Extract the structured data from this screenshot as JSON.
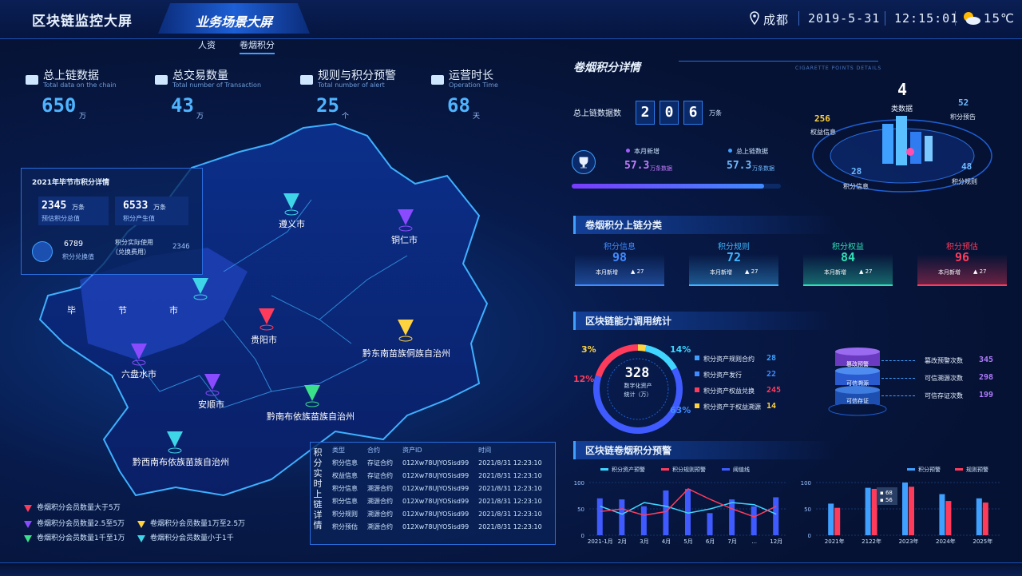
{
  "header": {
    "title": "区块链监控大屏",
    "active_tab": "业务场景大屏",
    "subtabs": [
      "人资",
      "卷烟积分"
    ],
    "city": "成都",
    "date": "2019-5-31",
    "time": "12:15:01",
    "temperature": "15℃",
    "icons": {
      "location": "location-pin-icon",
      "weather": "partly-cloudy-icon"
    }
  },
  "stats": [
    {
      "title": "总上链数据",
      "sub": "Total data on the chain",
      "value": "650",
      "unit": "万",
      "icon": "bank-icon"
    },
    {
      "title": "总交易数量",
      "sub": "Total number of Transaction",
      "value": "43",
      "unit": "万",
      "icon": "cash-register-icon"
    },
    {
      "title": "规则与积分预警",
      "sub": "Total number of alert",
      "value": "25",
      "unit": "个",
      "icon": "star-icon"
    },
    {
      "title": "运营时长",
      "sub": "Operation Time",
      "value": "68",
      "unit": "天",
      "icon": "clock-icon"
    }
  ],
  "popup": {
    "title": "2021年毕节市积分详情",
    "box1_value": "2345",
    "box1_unit": "万条",
    "box1_label": "预估积分总值",
    "box2_value": "6533",
    "box2_unit": "万条",
    "box2_label": "积分产生值",
    "exchange_value": "6789",
    "exchange_label": "积分兑换值",
    "usage_label1": "积分实际使用",
    "usage_label2": "（兑换费用）",
    "usage_value": "2346"
  },
  "map": {
    "regions": [
      "遵义市",
      "铜仁市",
      "毕",
      "节",
      "市",
      "贵阳市",
      "黔东南苗族侗族自治州",
      "六盘水市",
      "安顺市",
      "黔南布依族苗族自治州",
      "黔西南布依族苗族自治州"
    ],
    "legend": [
      {
        "label": "卷烟积分会员数量大于5万",
        "color": "#ff3b5c"
      },
      {
        "label": "卷烟积分会员数量2.5至5万",
        "color": "#8a4bff"
      },
      {
        "label": "卷烟积分会员数量1万至2.5万",
        "color": "#ffd23f"
      },
      {
        "label": "卷烟积分会员数量1千至1万",
        "color": "#3be08a"
      },
      {
        "label": "卷烟积分会员数量小于1千",
        "color": "#3fd5e8"
      }
    ]
  },
  "realtime": {
    "side_title": "积分实时上链详情",
    "headers": [
      "类型",
      "合约",
      "资产ID",
      "时间"
    ],
    "rows": [
      [
        "积分信息",
        "存证合约",
        "012Xw78UJYOSisd99",
        "2021/8/31 12:23:10"
      ],
      [
        "权益信息",
        "存证合约",
        "012Xw78UJYOSisd99",
        "2021/8/31 12:23:10"
      ],
      [
        "积分信息",
        "溯源合约",
        "012Xw78UJYOSisd99",
        "2021/8/31 12:23:10"
      ],
      [
        "积分信息",
        "溯源合约",
        "012Xw78UJYOSisd99",
        "2021/8/31 12:23:10"
      ],
      [
        "积分规则",
        "溯源合约",
        "012Xw78UJYOSisd99",
        "2021/8/31 12:23:10"
      ],
      [
        "积分预估",
        "溯源合约",
        "012Xw78UJYOSisd99",
        "2021/8/31 12:23:10"
      ]
    ]
  },
  "details": {
    "title": "卷烟积分详情",
    "subtitle": "CIGARETTE POINTS DETAILS",
    "total_label": "总上链数据数",
    "total_digits": [
      "2",
      "0",
      "6"
    ],
    "total_unit": "万条",
    "month_new_label": "本月新增",
    "month_new_value": "57.3",
    "month_new_unit": "万条数据",
    "total_chain_label": "总上链数据",
    "total_chain_value": "57.3",
    "total_chain_unit": "万条数据",
    "progress": 0.92,
    "ring": {
      "center_value": "4",
      "center_label": "类数据",
      "items": [
        {
          "value": "256",
          "label": "权益信息"
        },
        {
          "value": "52",
          "label": "积分预告"
        },
        {
          "value": "28",
          "label": "积分信息"
        },
        {
          "value": "48",
          "label": "积分规则"
        }
      ]
    }
  },
  "classify": {
    "title": "卷烟积分上链分类",
    "cards": [
      {
        "name": "积分信息",
        "value": "98",
        "new_label": "本月新增",
        "new_value": "▲ 27",
        "color": "#3f8bff"
      },
      {
        "name": "积分规则",
        "value": "72",
        "new_label": "本月新增",
        "new_value": "▲ 27",
        "color": "#3fb5ff"
      },
      {
        "name": "积分权益",
        "value": "84",
        "new_label": "本月新增",
        "new_value": "▲ 27",
        "color": "#2fe0b5"
      },
      {
        "name": "积分预估",
        "value": "96",
        "new_label": "本月新增",
        "new_value": "▲ 27",
        "color": "#ff3b5c"
      }
    ]
  },
  "ability": {
    "title": "区块链能力调用统计",
    "center_value": "328",
    "center_label1": "数字化资产",
    "center_label2": "统计（万）",
    "pct_labels": [
      "3%",
      "14%",
      "12%",
      "63%"
    ],
    "items": [
      {
        "label": "积分资产规则合约",
        "value": "28",
        "color": "#3fa0ff"
      },
      {
        "label": "积分资产发行",
        "value": "22",
        "color": "#3f8bff"
      },
      {
        "label": "积分资产权益兑换",
        "value": "245",
        "color": "#ff3b5c"
      },
      {
        "label": "积分资产于权益溯源",
        "value": "14",
        "color": "#ffd23f"
      }
    ],
    "stack_labels": [
      "篡改预警",
      "可信溯源",
      "可信存证"
    ],
    "right_items": [
      {
        "label": "篡改预警次数",
        "value": "345"
      },
      {
        "label": "可信溯源次数",
        "value": "298"
      },
      {
        "label": "可信存证次数",
        "value": "199"
      }
    ]
  },
  "chart_data": [
    {
      "type": "bar",
      "title": "区块链卷烟积分预警",
      "categories": [
        "2021-1月",
        "2月",
        "3月",
        "4月",
        "5月",
        "6月",
        "7月",
        "...",
        "12月"
      ],
      "ylim": [
        0,
        100
      ],
      "yticks": [
        "100",
        "50",
        "0"
      ],
      "series": [
        {
          "name": "积分资产预警",
          "type": "line",
          "color": "#3fd5ff",
          "values": [
            55,
            40,
            62,
            55,
            42,
            50,
            62,
            58,
            40
          ]
        },
        {
          "name": "积分规则预警",
          "type": "line",
          "color": "#ff3b5c",
          "values": [
            45,
            50,
            38,
            45,
            88,
            68,
            50,
            35,
            55
          ]
        },
        {
          "name": "阈值线",
          "type": "bar",
          "color": "#3f5bff",
          "values": [
            70,
            68,
            55,
            85,
            88,
            42,
            68,
            55,
            72
          ]
        }
      ]
    },
    {
      "type": "bar",
      "categories": [
        "2021年",
        "2122年",
        "2023年",
        "2024年",
        "2025年"
      ],
      "ylim": [
        0,
        100
      ],
      "yticks": [
        "100",
        "50",
        "0"
      ],
      "series": [
        {
          "name": "积分预警",
          "color": "#3fa0ff",
          "values": [
            60,
            90,
            100,
            78,
            70
          ]
        },
        {
          "name": "规则预警",
          "color": "#ff3b5c",
          "values": [
            52,
            88,
            92,
            65,
            62
          ]
        }
      ],
      "tooltip": [
        "68",
        "56"
      ]
    }
  ]
}
